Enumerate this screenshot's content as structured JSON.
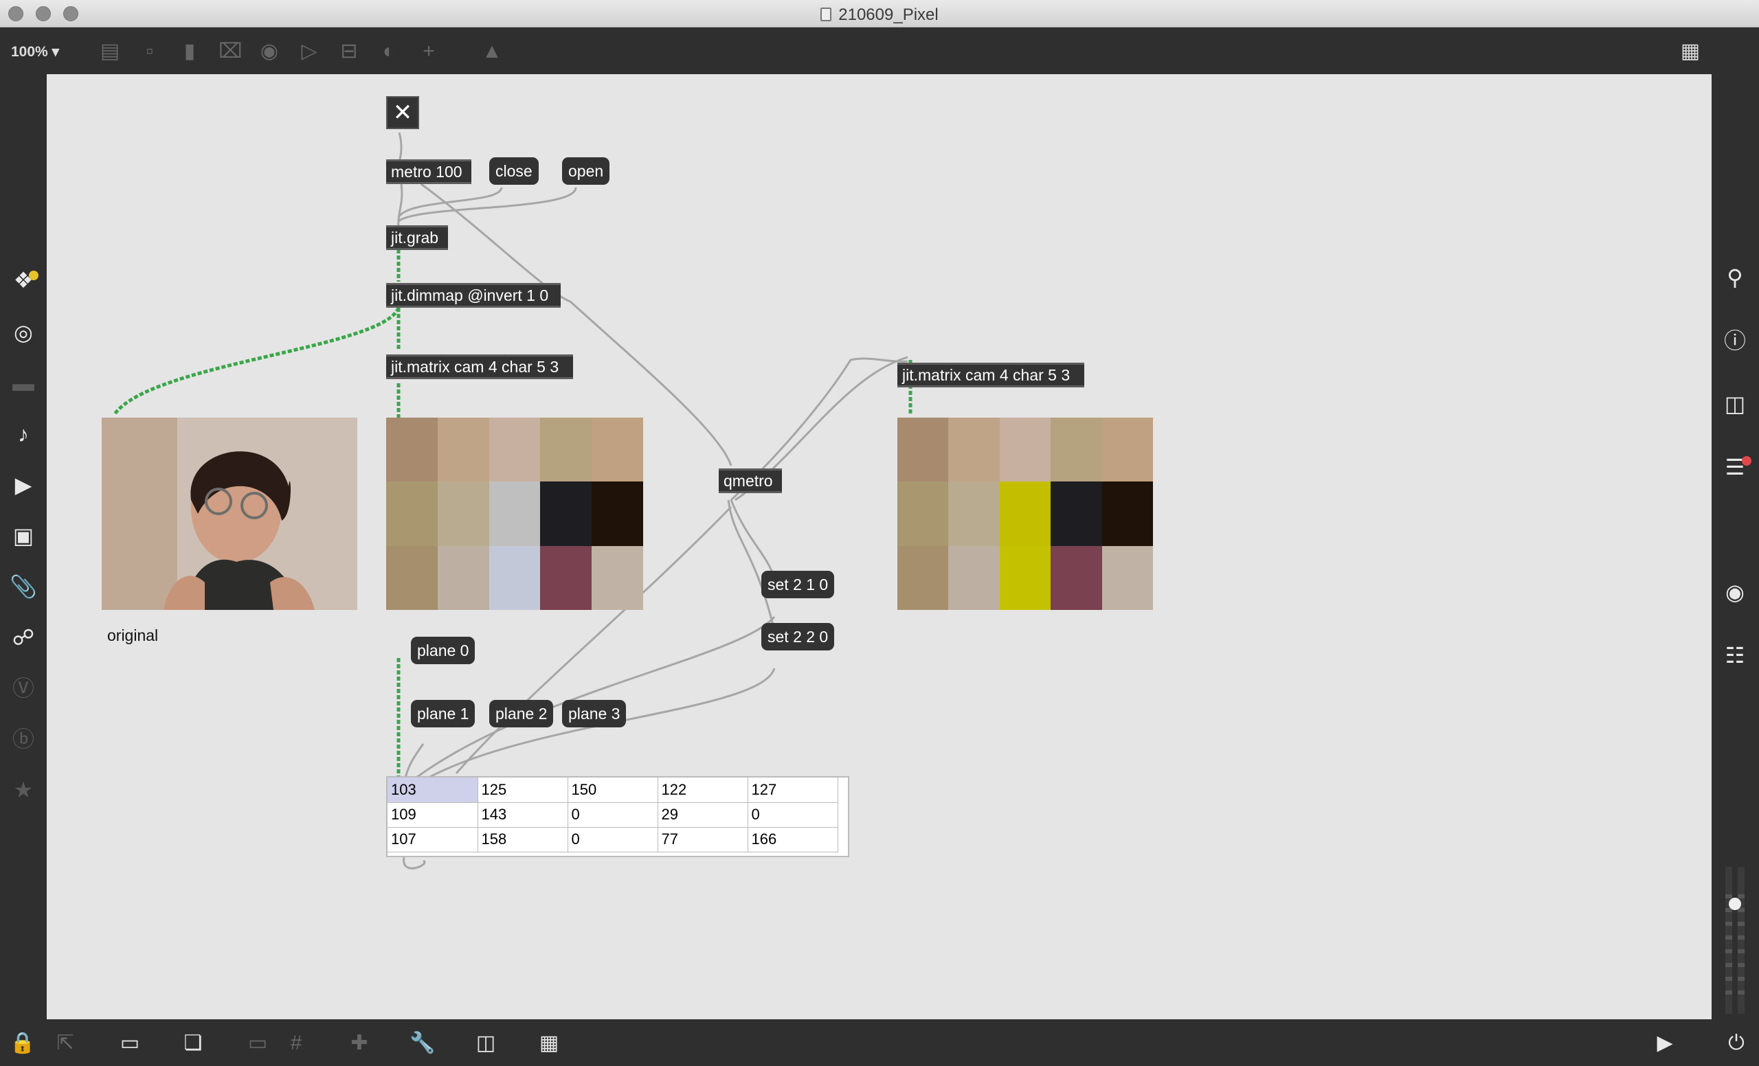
{
  "window": {
    "title": "210609_Pixel"
  },
  "toolbar": {
    "zoom_label": "100% ▾",
    "icons": [
      "object-box-icon",
      "message-box-icon",
      "comment-icon",
      "toggle-icon",
      "button-icon",
      "number-icon",
      "slider-icon",
      "dial-icon",
      "add-icon",
      "paint-bucket-icon",
      "grid-presentation-icon"
    ]
  },
  "patch": {
    "toggle_glyph": "✕",
    "objects": {
      "metro": "metro 100",
      "jit_grab": "jit.grab",
      "dimmap": "jit.dimmap @invert 1 0",
      "matrix_left": "jit.matrix cam 4 char 5 3",
      "matrix_right": "jit.matrix cam 4 char 5 3",
      "qmetro": "qmetro"
    },
    "messages": {
      "close": "close",
      "open": "open",
      "set_210": "set 2 1 0",
      "set_220": "set 2 2 0",
      "plane0": "plane 0",
      "plane1": "plane 1",
      "plane2": "plane 2",
      "plane3": "plane 3"
    },
    "comment_original": "original",
    "pixels_left": [
      "#a88a6f",
      "#bfa488",
      "#c8b0a0",
      "#b5a27f",
      "#c0a283",
      "#a8976f",
      "#b8ab8f",
      "#bfbfbf",
      "#1e1d22",
      "#1e1209",
      "#a58f6c",
      "#bdb0a2",
      "#c3c8d8",
      "#7a4151",
      "#c0b3a6"
    ],
    "pixels_right": [
      "#a88a6f",
      "#bfa488",
      "#c8b0a0",
      "#b5a27f",
      "#c0a283",
      "#a8976f",
      "#b8ab8f",
      "#c4be00",
      "#1e1d22",
      "#1e1209",
      "#a58f6c",
      "#bdb0a2",
      "#c4c200",
      "#7a4151",
      "#c0b3a6"
    ],
    "cell_values": [
      [
        "103",
        "125",
        "150",
        "122",
        "127"
      ],
      [
        "109",
        "143",
        "0",
        "29",
        "0"
      ],
      [
        "107",
        "158",
        "0",
        "77",
        "166"
      ]
    ]
  },
  "colors": {
    "canvas_bg": "#e5e5e5",
    "object_bg": "#333333",
    "matrix_cord": "#3aa64a",
    "cord": "#a8a8a8"
  }
}
